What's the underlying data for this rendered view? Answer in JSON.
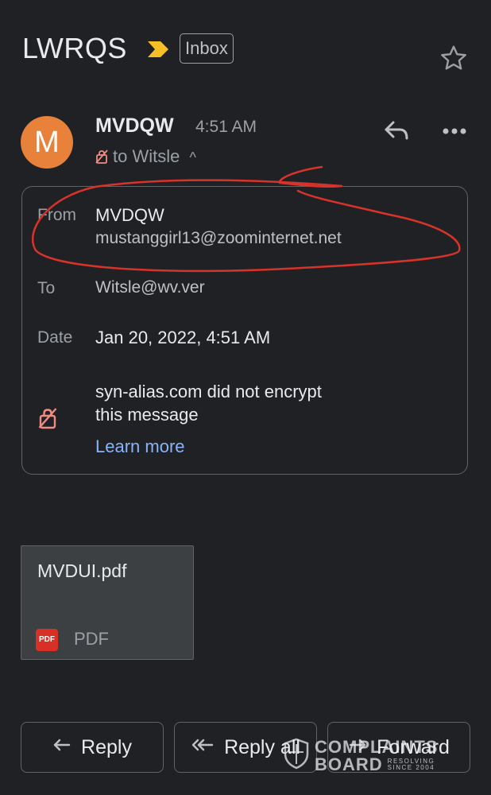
{
  "header": {
    "subject": "LWRQS",
    "label_badge": "Inbox",
    "icons": {
      "importance": "importance-arrow-icon",
      "star": "star-icon"
    }
  },
  "message": {
    "avatar_letter": "M",
    "sender_name": "MVDQW",
    "time": "4:51 AM",
    "to_summary": "to Witsle",
    "to_summary_chevron": "^",
    "icons": {
      "reply": "reply-icon",
      "more": "more-horiz-icon",
      "lock": "lock-off-icon"
    }
  },
  "details": {
    "from_label": "From",
    "from_name": "MVDQW",
    "from_email": "mustanggirl13@zoominternet.net",
    "to_label": "To",
    "to_value": "Witsle@wv.ver",
    "date_label": "Date",
    "date_value": "Jan 20, 2022, 4:51 AM",
    "encryption_line1": "syn-alias.com did not encrypt",
    "encryption_line2": "this message",
    "learn_more": "Learn more"
  },
  "attachment": {
    "filename": "MVDUI.pdf",
    "icon_text": "PDF",
    "type_label": "PDF"
  },
  "actions": {
    "reply": "Reply",
    "reply_all": "Reply all",
    "forward": "Forward"
  },
  "watermark": {
    "line1": "COMPLAINTS",
    "line2": "BOARD",
    "tag1": "RESOLVING",
    "tag2": "SINCE 2004"
  },
  "colors": {
    "background": "#202124",
    "avatar": "#e8823a",
    "link": "#8ab4f8",
    "importance": "#f6bf26",
    "annotation": "#d93025"
  }
}
